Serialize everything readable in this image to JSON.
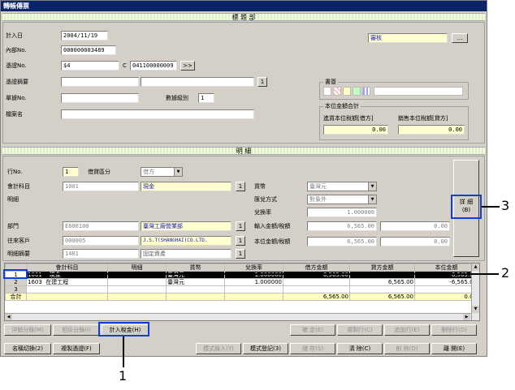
{
  "window_title": "轉帳傳票",
  "header_band": "標 題 部",
  "detail_band": "明 細",
  "header": {
    "date_label": "計入日",
    "date_value": "2004/11/19",
    "internal_no_label": "內部No.",
    "internal_no_value": "000000003489",
    "voucher_no_label": "憑證No.",
    "voucher_no_value": "$4",
    "voucher_c": "C",
    "voucher_code": "041100000009",
    "voucher_next": ">>",
    "summary_label": "憑證摘要",
    "summary_btn": "1",
    "doc_no_label": "單據No.",
    "level_label": "數據級別",
    "level_value": "1",
    "file_label": "檔案名",
    "review_value": "審核",
    "review_btn": "..."
  },
  "group_books": {
    "caption": "書簽"
  },
  "group_total": {
    "caption": "本位金額合計",
    "debit_label": "進貨本位稅額[借方]",
    "debit_value": "0.00",
    "credit_label": "銷售本位稅額[貸方]",
    "credit_value": "0.00"
  },
  "detail": {
    "line_label": "行No.",
    "line_value": "1",
    "dc_label": "借貸區分",
    "dc_value": "借方",
    "account_label": "會計科目",
    "account_code": "1001",
    "account_name": "現金",
    "account_btn": "1",
    "memo_label": "明細",
    "currency_label": "貨幣",
    "currency_value": "臺灣元",
    "rate_method_label": "匯兌方式",
    "rate_method_value": "對象外",
    "rate_label": "兌換率",
    "rate_value": "1.000000",
    "input_amount_label": "輸入金額/稅額",
    "input_amount_value": "6,565.00",
    "input_tax_value": "0.00",
    "base_amount_label": "本位金額/稅額",
    "base_amount_value": "6,565.00",
    "base_tax_value": "0.00",
    "dept_label": "部門",
    "dept_code": "E600100",
    "dept_name": "臺灣工廠營業部",
    "dept_btn": "1",
    "customer_label": "往來客戶",
    "customer_code": "000005",
    "customer_name": "J.S.T(SHANGHAI)CO.LTD.",
    "customer_btn": "1",
    "detail_memo_label": "明細摘要",
    "detail_memo_code": "1401",
    "detail_memo_name": "固定資產",
    "detail_memo_btn": "1",
    "detail_btn_line1": "詳 細",
    "detail_btn_line2": "(B)"
  },
  "grid": {
    "headers": [
      "會計科目",
      "",
      "明細",
      "貨幣",
      "兌換率",
      "借方金額",
      "貸方金額",
      "本位金額"
    ],
    "rows": [
      {
        "num": "1",
        "code": "1001",
        "name": "現金",
        "memo": "",
        "cur": "臺灣元",
        "rate": "1.000000",
        "debit": "6,565.00",
        "credit": "",
        "base": "6,565.00"
      },
      {
        "num": "2",
        "code": "1603",
        "name": "在建工程",
        "memo": "",
        "cur": "臺灣元",
        "rate": "1.000000",
        "debit": "",
        "credit": "6,565.00",
        "base": "-6,565.00"
      },
      {
        "num": "3",
        "code": "",
        "name": "",
        "memo": "",
        "cur": "",
        "rate": "",
        "debit": "",
        "credit": "",
        "base": ""
      }
    ],
    "total_label": "合計",
    "total_debit": "6,565.00",
    "total_credit": "6,565.00",
    "total_base": "0.00"
  },
  "buttons_row1": {
    "split": "沖銷分錄(M)",
    "offset": "相反分錄(I)",
    "tax": "計入稅金(H)",
    "confirm": "確 定(E)",
    "copy_row": "複製行(C)",
    "add_row": "追加行(E)",
    "delete_row": "刪除行(D)"
  },
  "buttons_row2": {
    "rename": "名稱切換(2)",
    "copy_voucher": "複製憑證(F)",
    "mode_input": "模式錄入(Y)",
    "mode_register": "模式登記(3)",
    "save": "儲 存(S)",
    "clear": "清 除(C)",
    "delete": "削 除(D)",
    "close": "離 開(E)"
  },
  "annotations": {
    "a1": "1",
    "a2": "2",
    "a3": "3"
  }
}
